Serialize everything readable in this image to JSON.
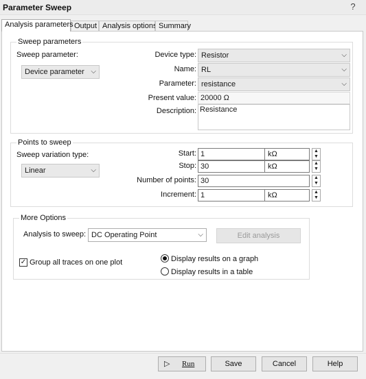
{
  "window": {
    "title": "Parameter Sweep",
    "help_icon": "question-mark-icon"
  },
  "tabs": [
    {
      "label": "Analysis parameters",
      "active": true
    },
    {
      "label": "Output",
      "active": false
    },
    {
      "label": "Analysis options",
      "active": false
    },
    {
      "label": "Summary",
      "active": false
    }
  ],
  "sweep_parameters": {
    "legend": "Sweep parameters",
    "sweep_parameter_label": "Sweep parameter:",
    "sweep_parameter_value": "Device parameter",
    "device_type_label": "Device type:",
    "device_type_value": "Resistor",
    "name_label": "Name:",
    "name_value": "RL",
    "parameter_label": "Parameter:",
    "parameter_value": "resistance",
    "present_value_label": "Present value:",
    "present_value": "20000 Ω",
    "description_label": "Description:",
    "description_value": "Resistance"
  },
  "points_to_sweep": {
    "legend": "Points to sweep",
    "variation_type_label": "Sweep variation type:",
    "variation_type_value": "Linear",
    "start_label": "Start:",
    "start_value": "1",
    "start_unit": "kΩ",
    "stop_label": "Stop:",
    "stop_value": "30",
    "stop_unit": "kΩ",
    "num_points_label": "Number of points:",
    "num_points_value": "30",
    "increment_label": "Increment:",
    "increment_value": "1",
    "increment_unit": "kΩ"
  },
  "more_options": {
    "legend": "More Options",
    "analysis_label": "Analysis to sweep:",
    "analysis_value": "DC Operating Point",
    "edit_analysis_label": "Edit analysis",
    "group_traces_label": "Group all traces on one plot",
    "group_traces_checked": true,
    "radio_graph_label": "Display results on a graph",
    "radio_table_label": "Display results in a table",
    "selected_radio": "graph"
  },
  "footer": {
    "run_label": "Run",
    "run_icon": "play-icon",
    "save_label": "Save",
    "cancel_label": "Cancel",
    "help_label": "Help"
  }
}
